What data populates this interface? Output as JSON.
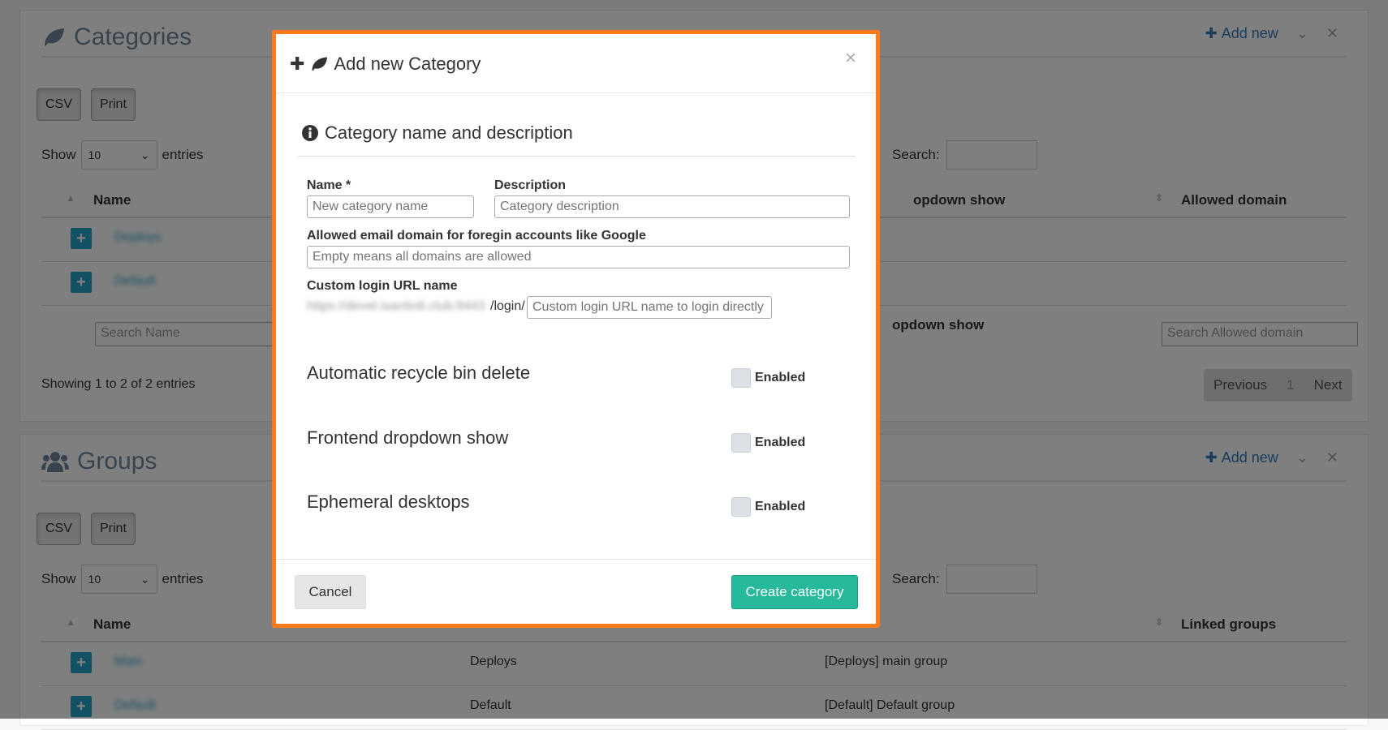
{
  "categories_panel": {
    "title": "Categories",
    "add_new": "Add new",
    "csv": "CSV",
    "print": "Print",
    "show": "Show",
    "entries_value": "10",
    "entries": "entries",
    "search": "Search:",
    "columns": [
      "Name",
      "opdown show",
      "Allowed domain"
    ],
    "rows": [
      "Deploys",
      "Default"
    ],
    "foot_search_name": "Search Name",
    "foot_col": "opdown show",
    "foot_search_domain": "Search Allowed domain",
    "showing": "Showing 1 to 2 of 2 entries",
    "pager": {
      "prev": "Previous",
      "page": "1",
      "next": "Next"
    }
  },
  "groups_panel": {
    "title": "Groups",
    "add_new": "Add new",
    "csv": "CSV",
    "print": "Print",
    "show": "Show",
    "entries_value": "10",
    "entries": "entries",
    "search": "Search:",
    "columns": [
      "Name",
      "Linked groups"
    ],
    "rows": [
      {
        "name": "Main",
        "category": "Deploys",
        "description": "[Deploys] main group"
      },
      {
        "name": "Default",
        "category": "Default",
        "description": "[Default] Default group"
      }
    ]
  },
  "modal": {
    "title": "Add new Category",
    "close": "×",
    "section_title": "Category name and description",
    "name_label": "Name *",
    "name_placeholder": "New category name",
    "description_label": "Description",
    "description_placeholder": "Category description",
    "domain_label": "Allowed email domain for foregin accounts like Google",
    "domain_placeholder": "Empty means all domains are allowed",
    "url_label": "Custom login URL name",
    "url_prefix": "https://devel.isardvdi.club:8443",
    "url_suffix": "/login/",
    "url_placeholder": "Custom login URL name to login directly",
    "options": [
      {
        "label": "Automatic recycle bin delete",
        "check": "Enabled"
      },
      {
        "label": "Frontend dropdown show",
        "check": "Enabled"
      },
      {
        "label": "Ephemeral desktops",
        "check": "Enabled"
      }
    ],
    "cancel": "Cancel",
    "create": "Create category"
  },
  "colors": {
    "accent_border": "#ff7b1a",
    "primary": "#26b99a",
    "link": "#337ab7"
  }
}
